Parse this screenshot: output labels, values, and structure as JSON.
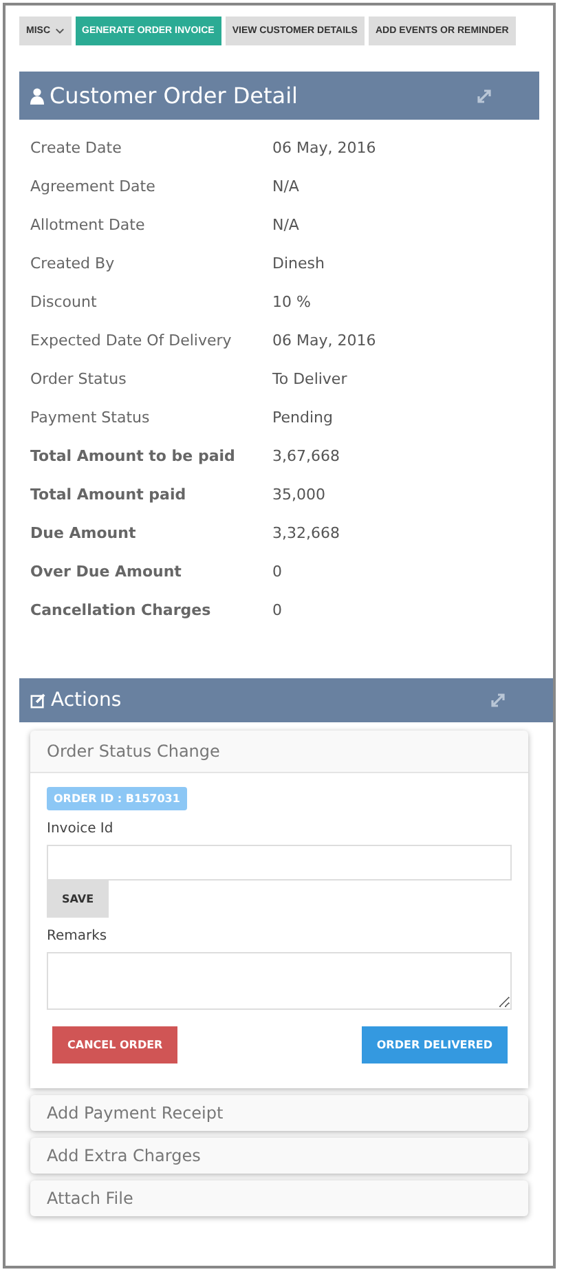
{
  "toolbar": [
    {
      "label": "MISC",
      "dropdown": true,
      "selected": false
    },
    {
      "label": "GENERATE ORDER INVOICE",
      "dropdown": false,
      "selected": true
    },
    {
      "label": "VIEW CUSTOMER DETAILS",
      "dropdown": false,
      "selected": false
    },
    {
      "label": "ADD EVENTS OR REMINDER",
      "dropdown": false,
      "selected": false
    }
  ],
  "detail": {
    "title": "Customer Order Detail",
    "rows": [
      {
        "label": "Create Date",
        "value": "06 May, 2016",
        "kind": "plain"
      },
      {
        "label": "Agreement Date",
        "value": "N/A",
        "kind": "plain"
      },
      {
        "label": "Allotment Date",
        "value": "N/A",
        "kind": "plain"
      },
      {
        "label": "Created By",
        "value": "Dinesh",
        "kind": "plain"
      },
      {
        "label": "Discount",
        "value": "10 %",
        "kind": "plain"
      },
      {
        "label": "Expected Date Of Delivery",
        "value": "06 May, 2016",
        "kind": "plain"
      },
      {
        "label": "Order Status",
        "value": "To Deliver",
        "kind": "plain"
      },
      {
        "label": "Payment Status",
        "value": "Pending",
        "kind": "plain"
      },
      {
        "label": "Total Amount to be paid",
        "value": "3,67,668",
        "kind": "total"
      },
      {
        "label": "Total Amount paid",
        "value": "35,000",
        "kind": "total"
      },
      {
        "label": "Due Amount",
        "value": "3,32,668",
        "kind": "total"
      },
      {
        "label": "Over Due Amount",
        "value": "0",
        "kind": "total"
      },
      {
        "label": "Cancellation Charges",
        "value": "0",
        "kind": "total"
      }
    ]
  },
  "actions": {
    "title": "Actions",
    "panels": [
      {
        "title": "Order Status Change",
        "expanded": true,
        "badge": "ORDER ID : B157031",
        "invoice_label": "Invoice Id",
        "save": "SAVE",
        "remarks_label": "Remarks",
        "cancel": "CANCEL ORDER",
        "deliver": "ORDER DELIVERED"
      },
      {
        "title": "Add Payment Receipt",
        "expanded": false
      },
      {
        "title": "Add Extra Charges",
        "expanded": false
      },
      {
        "title": "Attach File",
        "expanded": false
      }
    ]
  }
}
